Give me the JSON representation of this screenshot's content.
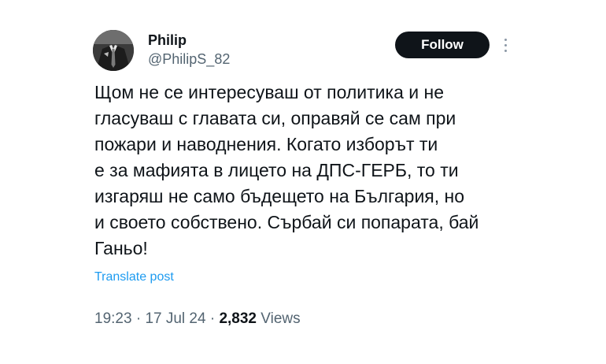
{
  "author": {
    "display_name": "Philip",
    "handle": "@PhilipS_82"
  },
  "follow_label": "Follow",
  "more_icon": "more-vertical-icon",
  "tweet_lines": [
    "Щом не се интересуваш от политика и не",
    "гласуваш с главата си, оправяй се сам при",
    "пожари и наводнения. Когато изборът ти",
    "е за мафията в лицето на ДПС-ГЕРБ, то ти",
    "изгаряш не само бъдещето на България, но",
    "и своето собствено. Сърбай си попарата, бай",
    "Ганьо!"
  ],
  "translate_label": "Translate post",
  "meta": {
    "time": "19:23",
    "separator": "·",
    "date": "17 Jul 24",
    "views_count": "2,832",
    "views_label": "Views"
  },
  "colors": {
    "text_primary": "#0f1419",
    "text_secondary": "#536471",
    "link": "#1d9bf0",
    "button_bg": "#0f1419"
  }
}
